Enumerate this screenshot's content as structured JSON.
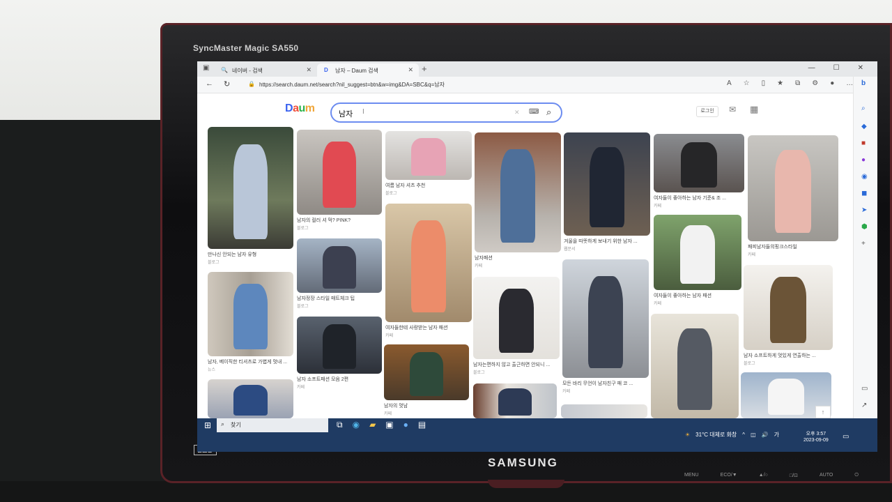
{
  "monitor": {
    "brand_text": "SyncMaster Magic SA550",
    "led_text": "LED",
    "maker": "SAMSUNG",
    "buttons": [
      "MENU",
      "ECO/▼",
      "▲/○",
      "□/⊡",
      "AUTO",
      "⏻"
    ]
  },
  "browser": {
    "tabs": [
      {
        "icon": "naver-icon",
        "title": "네이버 - 검색"
      },
      {
        "icon": "daum-icon",
        "title": "남자 – Daum 검색"
      }
    ],
    "url": "https://search.daum.net/search?nil_suggest=btn&w=img&DA=SBC&q=남자"
  },
  "daum": {
    "logo": "Daum",
    "search_query": "남자",
    "login_label": "로그인"
  },
  "results": [
    {
      "caption": "만나신 안되는 남자 유형",
      "source": "블로그"
    },
    {
      "caption": "남자의 컬러 셔 먹? PINK?",
      "source": "블로그"
    },
    {
      "caption": "여름 남자 셔츠 추천",
      "source": "블로그"
    },
    {
      "caption": "남자패션",
      "source": "카페"
    },
    {
      "caption": "겨울을 따뜻하게 보내기 위한 남자 ...",
      "source": "웹문서"
    },
    {
      "caption": "여자들이 좋아하는 남자 기준& 조 ...",
      "source": "카페"
    },
    {
      "caption": "패피남자들의핑크스타일",
      "source": "카페"
    },
    {
      "caption": "남자, 베이직한 티셔츠로 가볍게 멋내 ...",
      "source": "뉴스"
    },
    {
      "caption": "남자정장 스타일 매트체크 팁",
      "source": "블로그"
    },
    {
      "caption": "여자들한테 사랑받는 남자 패션",
      "source": "카페"
    },
    {
      "caption": "여자들이 좋아하는 남자 패션",
      "source": "카페"
    },
    {
      "caption": "남자 소프트하게 멋있게 연출하는 ...",
      "source": "블로그"
    },
    {
      "caption": "남자 소프트패션 모음 2편",
      "source": "카페"
    },
    {
      "caption": "남자는편하지 않고 출근하면 안되니 ...",
      "source": "블로그"
    },
    {
      "caption": "모든 바리 무언이 남자친구 패 코 ...",
      "source": "카페"
    },
    {
      "caption": "남자의 멋남",
      "source": "카페"
    }
  ],
  "taskbar": {
    "search_placeholder": "찾기",
    "weather": "31°C 대체로 화창",
    "time": "오후 3:57",
    "date": "2023-09-09"
  }
}
